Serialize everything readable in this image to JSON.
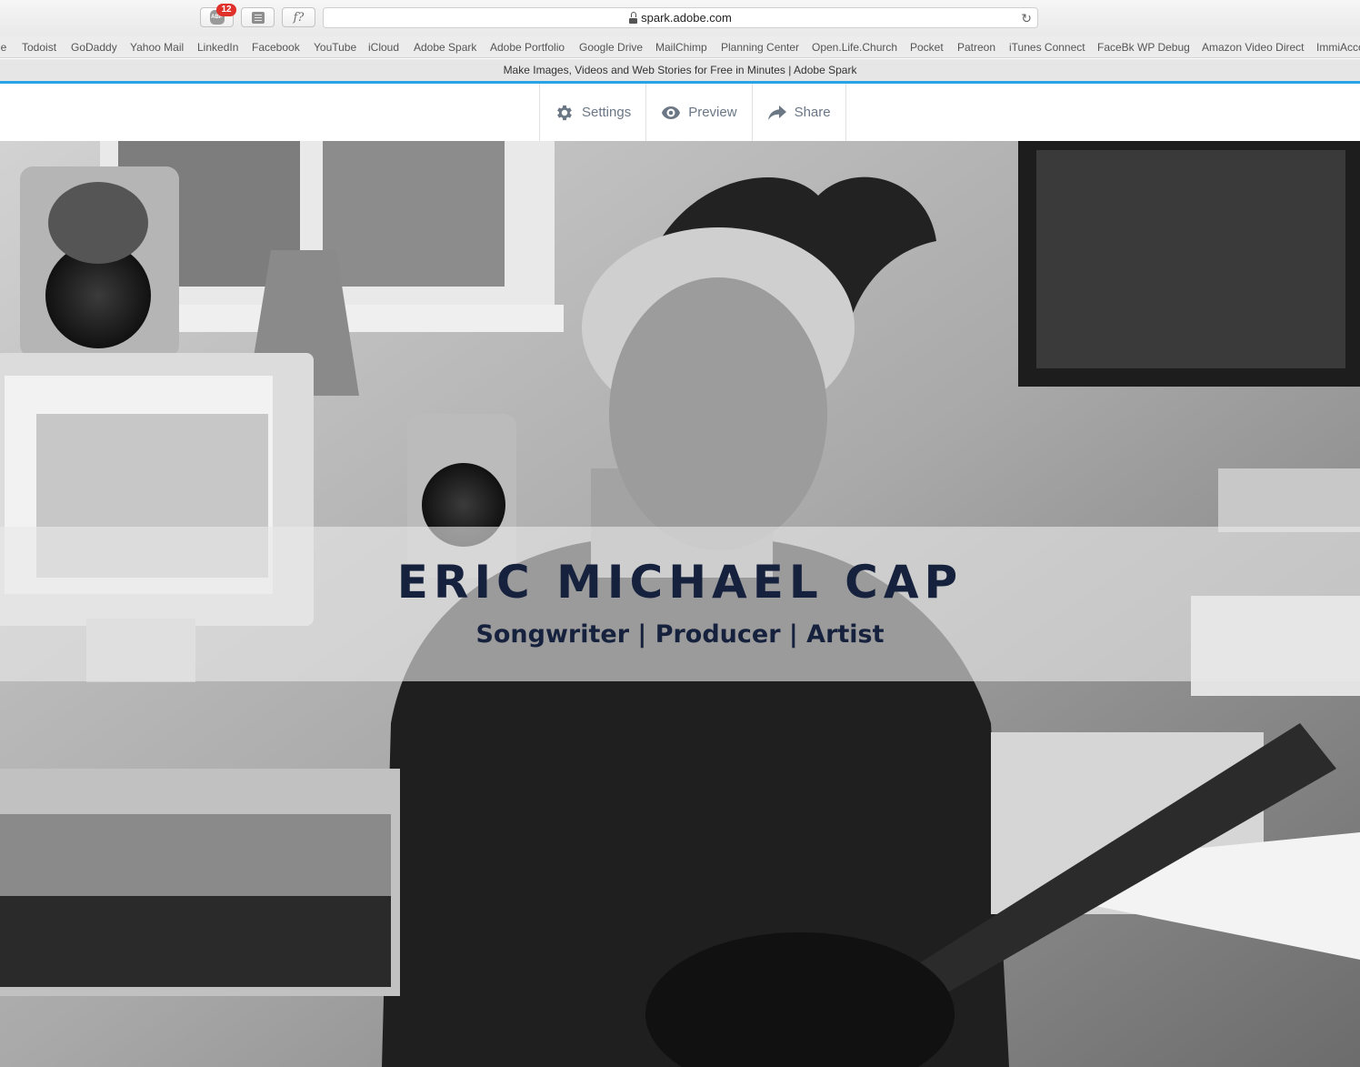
{
  "browser": {
    "extensions": {
      "adblock_badge": "12",
      "adblock_label": "ABP",
      "func_label": "f?"
    },
    "address": "spark.adobe.com",
    "bookmarks": [
      "le",
      "Todoist",
      "GoDaddy",
      "Yahoo Mail",
      "LinkedIn",
      "Facebook",
      "YouTube",
      "iCloud",
      "Adobe Spark",
      "Adobe Portfolio",
      "Google Drive",
      "MailChimp",
      "Planning Center",
      "Open.Life.Church",
      "Pocket",
      "Patreon",
      "iTunes Connect",
      "FaceBk WP Debug",
      "Amazon Video Direct",
      "ImmiAcco"
    ],
    "tab_title": "Make Images, Videos and Web Stories for Free in Minutes | Adobe Spark"
  },
  "spark": {
    "settings_label": "Settings",
    "preview_label": "Preview",
    "share_label": "Share"
  },
  "hero": {
    "title": "ERIC MICHAEL CAP",
    "subtitle": "Songwriter | Producer | Artist"
  },
  "colors": {
    "accent": "#2aa3e6",
    "title_text": "#16213d",
    "spark_icon": "#6b7785",
    "badge": "#e0302a"
  }
}
